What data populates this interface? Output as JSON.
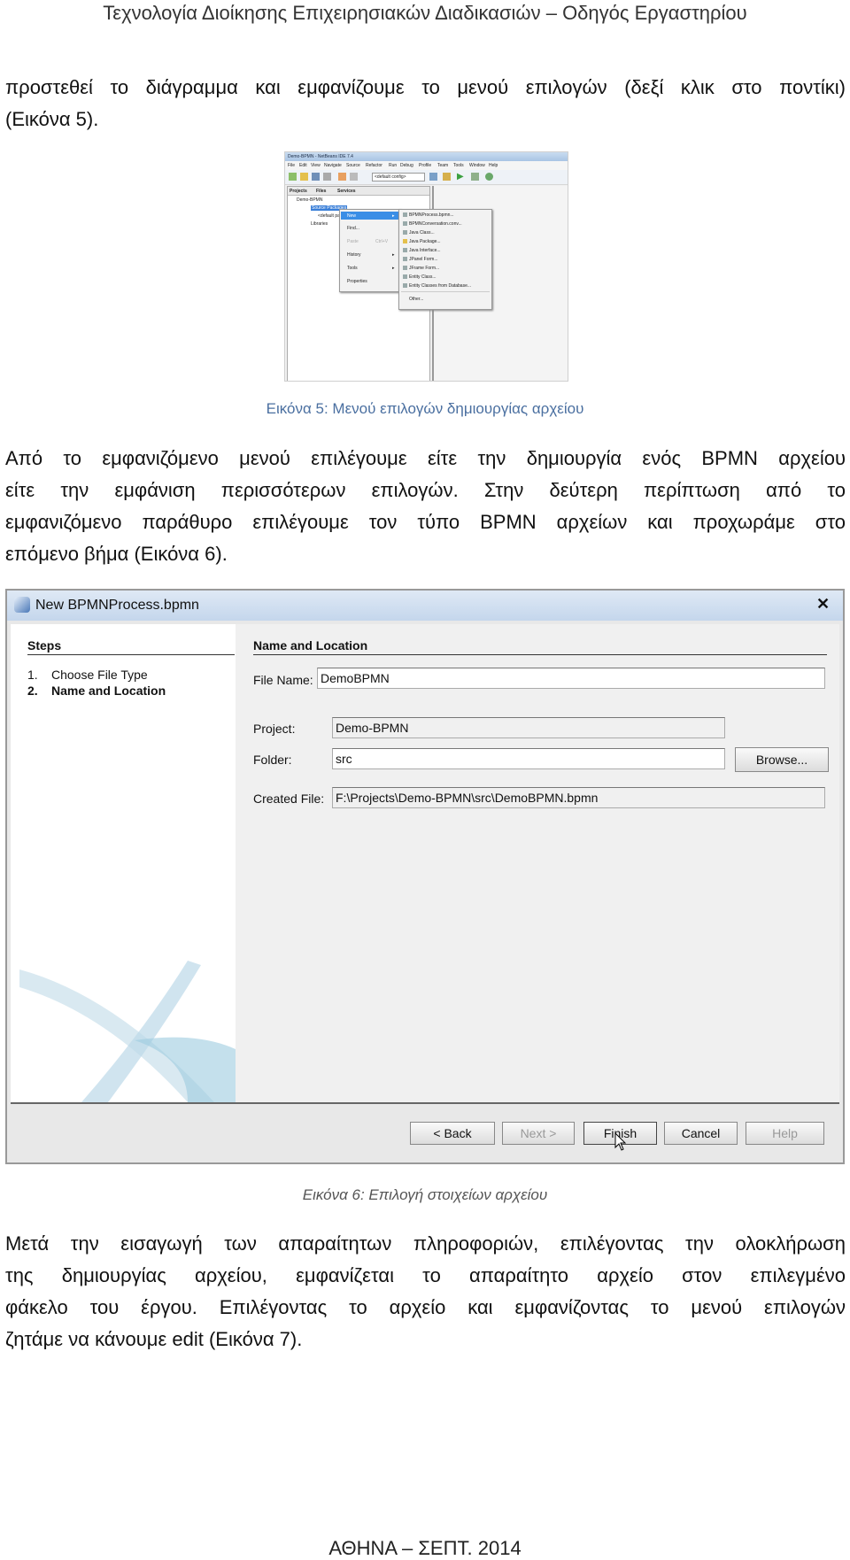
{
  "header": "Τεχνολογία Διοίκησης Επιχειρησιακών Διαδικασιών – Οδηγός Εργαστηρίου",
  "paragraph1": [
    "προστεθεί το διάγραμμα και εμφανίζουμε το μενού επιλογών (δεξί κλικ στο ποντίκι)",
    "(Εικόνα 5)."
  ],
  "figure5": {
    "caption": "Εικόνα 5: Μενού επιλογών δημιουργίας αρχείου",
    "window_title": "Demo-BPMN - NetBeans IDE 7.4",
    "menubar": [
      "File",
      "Edit",
      "View",
      "Navigate",
      "Source",
      "Refactor",
      "Run",
      "Debug",
      "Profile",
      "Team",
      "Tools",
      "Window",
      "Help"
    ],
    "config_combo": "<default config>",
    "panel_tabs": [
      "Projects",
      "Files",
      "Services"
    ],
    "tree": [
      "Demo-BPMN",
      "Source Packages",
      "<default package>",
      "Libraries"
    ],
    "context_menu": [
      {
        "label": "New",
        "shortcut": "▸"
      },
      {
        "label": "Find...",
        "shortcut": ""
      },
      {
        "label": "Paste",
        "shortcut": "Ctrl+V"
      },
      {
        "label": "History",
        "shortcut": "▸"
      },
      {
        "label": "Tools",
        "shortcut": "▸"
      },
      {
        "label": "Properties",
        "shortcut": ""
      }
    ],
    "submenu": [
      "BPMNProcess.bpmn...",
      "BPMNConversation.conv...",
      "Java Class...",
      "Java Package...",
      "Java Interface...",
      "JPanel Form...",
      "JFrame Form...",
      "Entity Class...",
      "Entity Classes from Database...",
      "Other..."
    ]
  },
  "paragraph2": [
    "Από το εμφανιζόμενο μενού επιλέγουμε είτε την δημιουργία ενός BPMN αρχείου",
    "είτε την εμφάνιση περισσότερων επιλογών. Στην δεύτερη περίπτωση από το",
    "εμφανιζόμενο παράθυρο επιλέγουμε τον τύπο BPMN αρχείων και προχωράμε στο",
    "επόμενο βήμα (Εικόνα 6)."
  ],
  "figure6": {
    "caption": "Εικόνα 6: Επιλογή στοιχείων αρχείου",
    "title": "New BPMNProcess.bpmn",
    "close": "✕",
    "steps_heading": "Steps",
    "steps": [
      {
        "num": "1.",
        "label": "Choose File Type"
      },
      {
        "num": "2.",
        "label": "Name and Location"
      }
    ],
    "section_heading": "Name and Location",
    "file_name_label": "File Name:",
    "file_name_value": "DemoBPMN",
    "project_label": "Project:",
    "project_value": "Demo-BPMN",
    "folder_label": "Folder:",
    "folder_value": "src",
    "browse_label": "Browse...",
    "created_file_label": "Created File:",
    "created_file_value": "F:\\Projects\\Demo-BPMN\\src\\DemoBPMN.bpmn",
    "buttons": {
      "back": "< Back",
      "next": "Next >",
      "finish": "Finish",
      "cancel": "Cancel",
      "help": "Help"
    }
  },
  "paragraph3": [
    "Μετά την εισαγωγή των απαραίτητων πληροφοριών, επιλέγοντας την ολοκλήρωση",
    "της δημιουργίας αρχείου, εμφανίζεται το απαραίτητο αρχείο στον επιλεγμένο",
    "φάκελο του έργου. Επιλέγοντας το αρχείο και εμφανίζοντας το μενού επιλογών",
    "ζητάμε να κάνουμε edit (Εικόνα 7)."
  ],
  "footer": "ΑΘΗΝΑ – ΣΕΠΤ. 2014"
}
